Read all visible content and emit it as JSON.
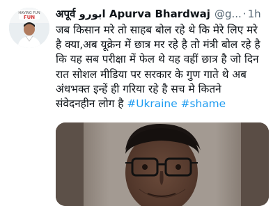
{
  "tweet": {
    "avatar_badge_text": "HAVING FUN",
    "display_name": "अपूर्व ابورو Apurva Bhardwaj",
    "handle": "@g...",
    "separator": "·",
    "time": "1h",
    "text_lines": [
      "जब किसान मरे तो साहब बोल रहे थे कि मेरे लिए मरे",
      "है क्या,अब यूक्रेन में छात्र मर रहे है तो मंत्री बोल रहे है",
      "कि यह सब परीक्षा में फेल थे यह वहीं छात्र है जो दिन",
      "रात सोशल मीडिया पर सरकार के गुण गाते थे अब",
      "अंधभक्त इन्हें ही गरिया रहे है सच मे कितने"
    ],
    "last_line_text": "संवेदनहीन लोग है",
    "hashtags": [
      "#Ukraine",
      "#shame"
    ],
    "colors": {
      "text": "#0f1419",
      "secondary": "#536471",
      "link": "#1d9bf0"
    },
    "media": {
      "icon": "photo-of-young-man-with-glasses"
    }
  }
}
